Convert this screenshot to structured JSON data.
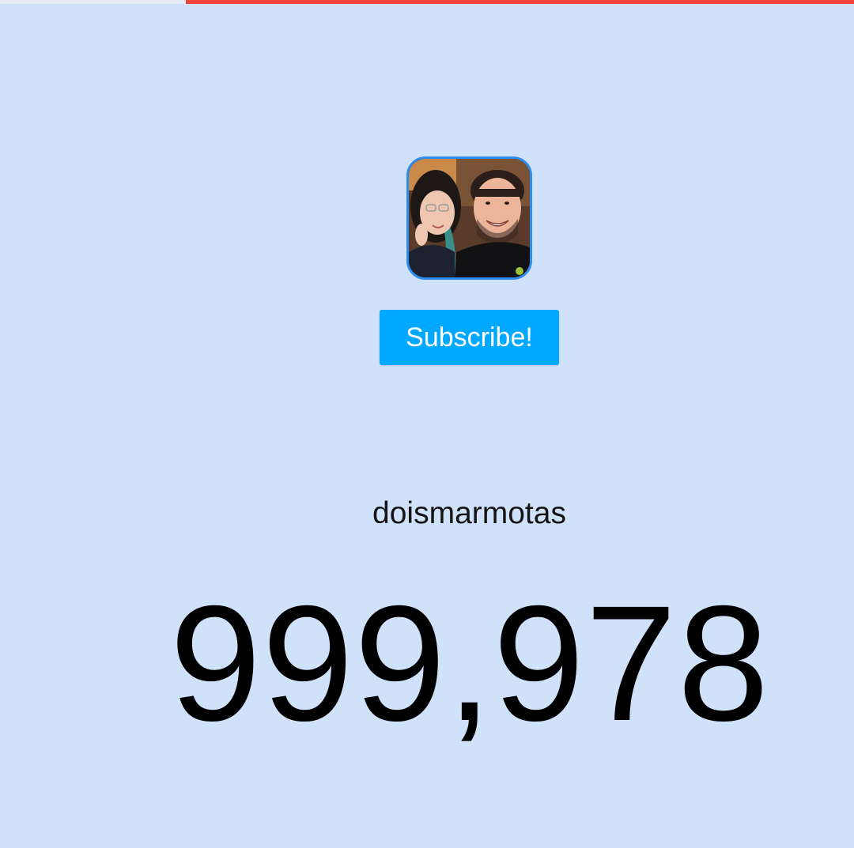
{
  "progress": {
    "fraction": 0.78,
    "color": "#f0433a"
  },
  "avatar": {
    "icon": "channel-avatar-photo",
    "border_color": "#2d8cf0"
  },
  "subscribe": {
    "label": "Subscribe!",
    "color": "#00a8ff"
  },
  "channel": {
    "name": "doismarmotas"
  },
  "count": {
    "value": "999,978"
  },
  "colors": {
    "background": "#cfe2fa",
    "text": "#000000"
  }
}
